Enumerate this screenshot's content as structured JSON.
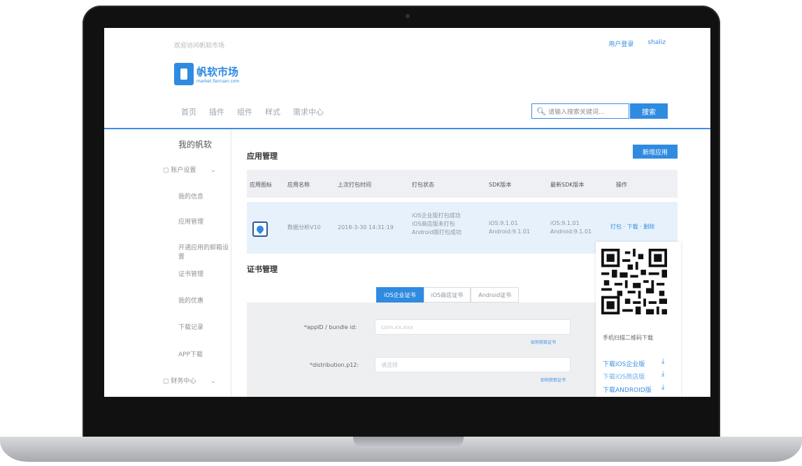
{
  "header": {
    "welcome": "欢迎访问帆软市场",
    "login": "用户登录",
    "user": "shaliz"
  },
  "logo": {
    "title": "帆软市场",
    "subtitle": "market.fanruan.com"
  },
  "nav": [
    "首页",
    "插件",
    "组件",
    "样式",
    "需求中心"
  ],
  "search": {
    "placeholder": "请输入搜索关键词...",
    "button": "搜索"
  },
  "sidebar": {
    "title": "我的帆软",
    "group1": "账户设置",
    "items": [
      "我的信息",
      "应用管理",
      "开通应用的邮箱设置",
      "证书管理",
      "我的优惠",
      "下载记录",
      "APP下载"
    ],
    "group2": "财务中心"
  },
  "apps": {
    "title": "应用管理",
    "add_button": "新增应用",
    "columns": [
      "应用图标",
      "应用名称",
      "上次打包时间",
      "打包状态",
      "SDK版本",
      "最新SDK版本",
      "操作"
    ],
    "row": {
      "name": "数据分析V10",
      "time": "2018-3-30 14:31:19",
      "status": [
        "iOS企业版打包成功",
        "iOS商店版未打包",
        "Android版打包成功"
      ],
      "sdk": [
        "iOS:9.1.01",
        "Android:9.1.01"
      ],
      "latest_sdk": [
        "iOS:9.1.01",
        "Android:9.1.01"
      ],
      "ops": "打包 · 下载 · 删除"
    }
  },
  "certs": {
    "title": "证书管理",
    "tabs": [
      "iOS企业证书",
      "iOS商店证书",
      "Android证书"
    ],
    "appid_label": "*appID / bundle id:",
    "appid_placeholder": "com.xx.xxx",
    "appid_hint": "如何获取证书",
    "p12_label": "*distribution.p12:",
    "p12_placeholder": "请选择",
    "p12_hint": "如何获取证书"
  },
  "download": {
    "caption": "手机扫描二维码下载",
    "links": [
      "下载iOS企业版",
      "下载iOS商店版",
      "下载ANDROID版"
    ]
  }
}
